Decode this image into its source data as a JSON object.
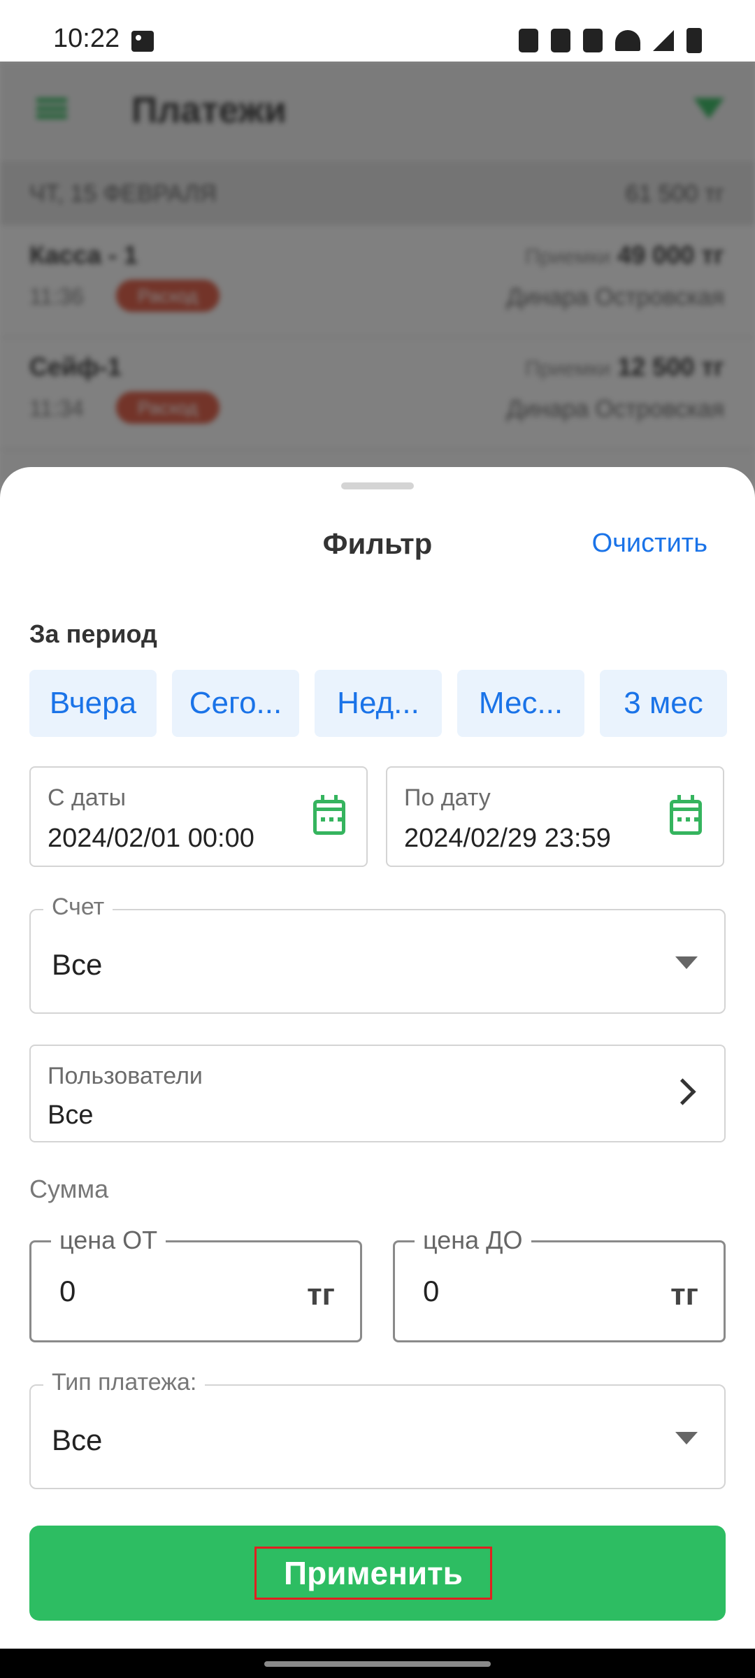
{
  "status_bar": {
    "time": "10:22"
  },
  "background": {
    "title": "Платежи",
    "date_header": "ЧТ, 15 ФЕВРАЛЯ",
    "date_total": "61 500 тг",
    "rows": [
      {
        "name": "Касса - 1",
        "time": "11:36",
        "badge": "Расход",
        "amount_label": "Приемки",
        "amount": "49 000 тг",
        "person": "Динара Островская"
      },
      {
        "name": "Сейф-1",
        "time": "11:34",
        "badge": "Расход",
        "amount_label": "Приемки",
        "amount": "12 500 тг",
        "person": "Динара Островская"
      }
    ]
  },
  "sheet": {
    "title": "Фильтр",
    "clear_label": "Очистить",
    "period_label": "За период",
    "period_chips": [
      "Вчера",
      "Сего...",
      "Нед...",
      "Мес...",
      "3 мес"
    ],
    "from_date_label": "С даты",
    "from_date_value": "2024/02/01 00:00",
    "to_date_label": "По дату",
    "to_date_value": "2024/02/29 23:59",
    "account_label": "Счет",
    "account_value": "Все",
    "users_label": "Пользователи",
    "users_value": "Все",
    "sum_label": "Сумма",
    "price_from_label": "цена ОТ",
    "price_from_value": "0",
    "price_to_label": "цена ДО",
    "price_to_value": "0",
    "currency": "тг",
    "payment_type_label": "Тип платежа:",
    "payment_type_value": "Все",
    "apply_label": "Применить"
  },
  "colors": {
    "accent_green": "#2dbd62",
    "link_blue": "#1a73e8",
    "highlight_red": "#e02020"
  }
}
